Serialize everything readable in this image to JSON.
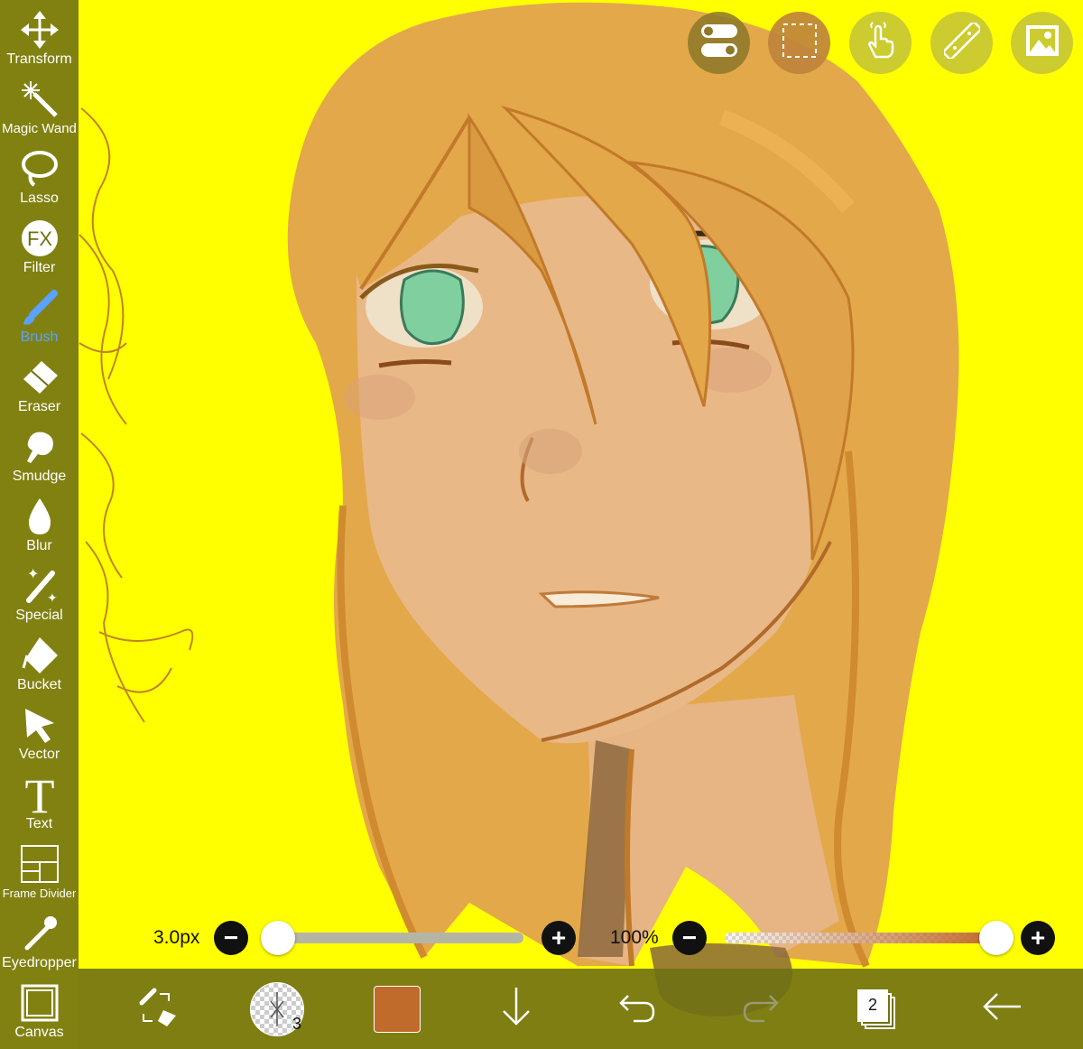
{
  "tools": [
    {
      "label": "Transform",
      "icon": "transform-icon"
    },
    {
      "label": "Magic Wand",
      "icon": "magic-wand-icon"
    },
    {
      "label": "Lasso",
      "icon": "lasso-icon"
    },
    {
      "label": "Filter",
      "icon": "fx-icon"
    },
    {
      "label": "Brush",
      "icon": "brush-icon",
      "active": true
    },
    {
      "label": "Eraser",
      "icon": "eraser-icon"
    },
    {
      "label": "Smudge",
      "icon": "smudge-icon"
    },
    {
      "label": "Blur",
      "icon": "blur-drop-icon"
    },
    {
      "label": "Special",
      "icon": "special-icon"
    },
    {
      "label": "Bucket",
      "icon": "bucket-icon"
    },
    {
      "label": "Vector",
      "icon": "vector-arrow-icon"
    },
    {
      "label": "Text",
      "icon": "text-icon"
    },
    {
      "label": "Frame Divider",
      "icon": "frame-divider-icon"
    },
    {
      "label": "Eyedropper",
      "icon": "eyedropper-icon"
    },
    {
      "label": "Canvas",
      "icon": "canvas-icon"
    }
  ],
  "top_buttons": [
    "toggle-icon",
    "selection-icon",
    "touch-icon",
    "ruler-icon",
    "material-icon"
  ],
  "brush_size": {
    "label": "3.0px",
    "value": 3.0
  },
  "opacity": {
    "label": "100%",
    "value": 1.0
  },
  "brush_preview_number": "3",
  "layers_count": "2",
  "colors": {
    "accent_active": "#5aa2ff",
    "current_color": "#c06a2c",
    "background": "#ffff00",
    "toolbar": "#707014"
  }
}
